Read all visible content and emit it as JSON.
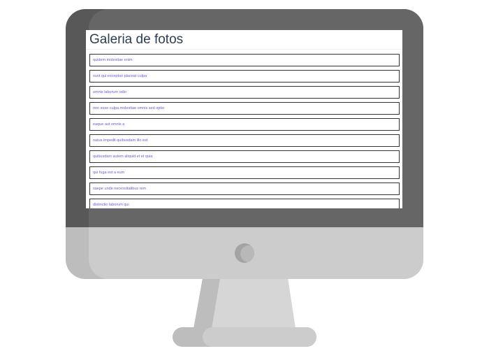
{
  "page": {
    "title": "Galeria de fotos"
  },
  "albums": [
    "quidem molestiae enim",
    "sunt qui excepturi placeat culpa",
    "omnis laborum odio",
    "non esse culpa molestiae omnis sed optio",
    "eaque aut omnis a",
    "natus impedit quibusdam illo est",
    "quibusdam autem aliquid et et quia",
    "qui fuga est a eum",
    "saepe unde necessitatibus rem",
    "distinctio laborum qui"
  ],
  "colors": {
    "title": "#2d3e50",
    "link": "#6b5bd6",
    "item_border": "#333333",
    "bezel": "#666666",
    "chin": "#cccccc"
  }
}
